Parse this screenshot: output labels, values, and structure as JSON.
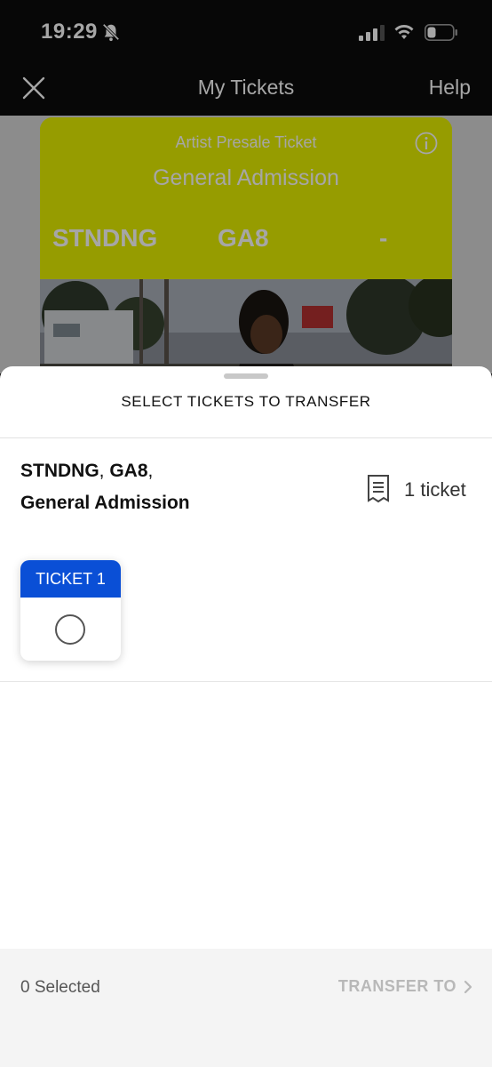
{
  "status_bar": {
    "time": "19:29"
  },
  "nav": {
    "title": "My Tickets",
    "help_label": "Help"
  },
  "background_ticket": {
    "subtitle": "Artist Presale Ticket",
    "title": "General Admission",
    "section": "STNDNG",
    "row": "GA8",
    "seat": "-",
    "color": "#e6f000"
  },
  "sheet": {
    "title": "SELECT TICKETS TO TRANSFER",
    "section": "STNDNG",
    "row": "GA8",
    "area": "General Admission",
    "ticket_count": "1 ticket",
    "ticket_label": "TICKET 1",
    "selected_text": "0 Selected",
    "transfer_label": "TRANSFER TO",
    "accent": "#0a4fd6"
  }
}
